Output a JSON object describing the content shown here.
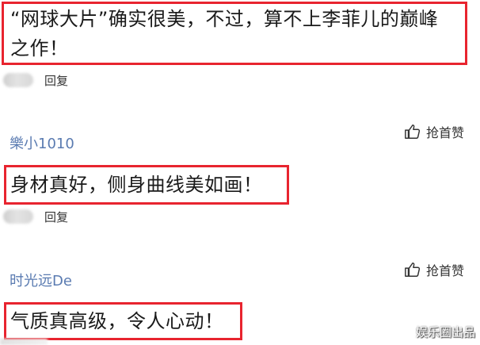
{
  "comments": [
    {
      "username": "",
      "text_lines": [
        "“网球大片”确实很美，不过，算不上李菲儿的巅峰",
        "之作！"
      ],
      "reply_label": "回复"
    },
    {
      "username": "樂小1010",
      "like_label": "抢首赞",
      "text_lines": [
        "身材真好，侧身曲线美如画！"
      ],
      "reply_label": "回复"
    },
    {
      "username": "时光远De",
      "like_label": "抢首赞",
      "text_lines": [
        "气质真高级，令人心动！"
      ]
    }
  ],
  "watermark": "娱乐圈出品",
  "icons": {
    "like": "thumbs-up-icon",
    "avatar": "blurred-avatar"
  },
  "colors": {
    "highlight_border": "#e8242f",
    "username": "#5a7bb1",
    "text": "#1a1a1a"
  }
}
